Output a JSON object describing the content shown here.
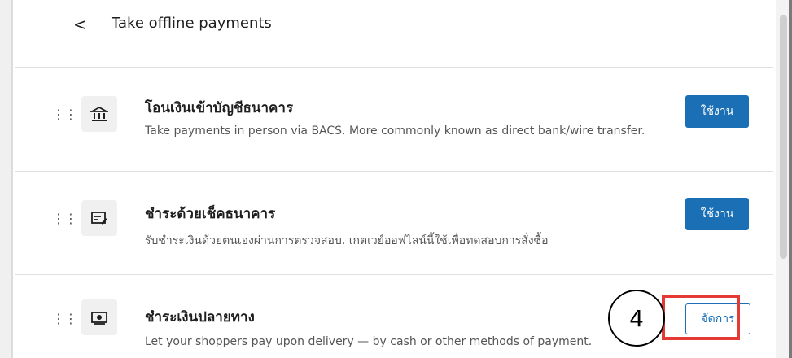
{
  "header": {
    "back_label": "<",
    "title": "Take offline payments"
  },
  "methods": [
    {
      "title": "โอนเงินเข้าบัญชีธนาคาร",
      "description": "Take payments in person via BACS. More commonly known as direct bank/wire transfer.",
      "action_label": "ใช้งาน",
      "icon": "bank-icon"
    },
    {
      "title": "ชำระด้วยเช็คธนาคาร",
      "description": "รับชำระเงินด้วยตนเองผ่านการตรวจสอบ. เกตเวย์ออฟไลน์นี้ใช้เพื่อทดสอบการสั่งซื้อ",
      "action_label": "ใช้งาน",
      "icon": "cheque-icon"
    },
    {
      "title": "ชำระเงินปลายทาง",
      "description": "Let your shoppers pay upon delivery — by cash or other methods of payment.",
      "action_label": "จัดการ",
      "icon": "cash-icon"
    }
  ],
  "annotation": {
    "step_number": "4",
    "highlight_color": "#e53935"
  },
  "colors": {
    "primary": "#1a6fb5"
  }
}
